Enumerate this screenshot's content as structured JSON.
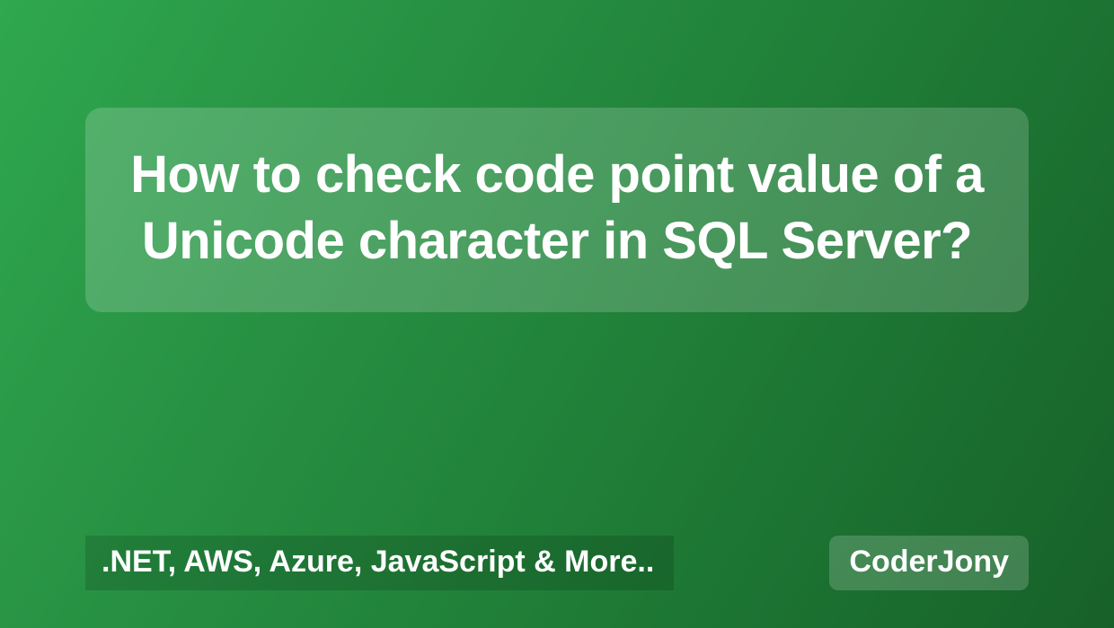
{
  "title": "How to check code point value of a Unicode character in SQL Server?",
  "tagline": ".NET, AWS, Azure, JavaScript & More..",
  "brand": "CoderJony"
}
